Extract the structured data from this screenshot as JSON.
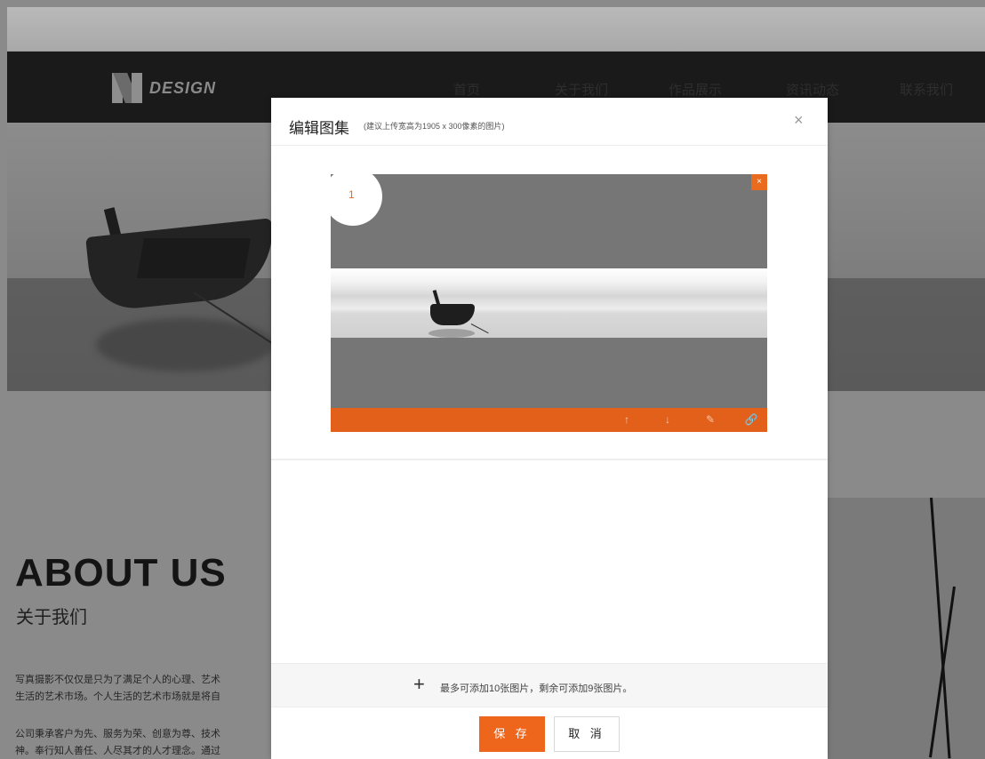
{
  "background_site": {
    "logo_text": "DESIGN",
    "nav": [
      "首页",
      "关于我们",
      "作品展示",
      "资讯动态",
      "联系我们"
    ],
    "about_title": "ABOUT US",
    "about_subtitle": "关于我们",
    "paragraph1_line1": "写真摄影不仅仅是只为了满足个人的心理、艺术",
    "paragraph1_line2": "生活的艺术市场。个人生活的艺术市场就是将自",
    "paragraph2_line1": "公司秉承客户为先、服务为荣、创意为尊、技术",
    "paragraph2_line2": "神。奉行知人善任、人尽其才的人才理念。通过"
  },
  "modal": {
    "title": "编辑图集",
    "hint": "(建议上传宽高为1905 x 300像素的图片)",
    "close_glyph": "×",
    "images": [
      {
        "index": "1",
        "delete_glyph": "×",
        "actions": {
          "move_up": "↑",
          "move_down": "↓",
          "edit": "✎",
          "link": "🔗"
        }
      }
    ],
    "add_glyph": "+",
    "add_text": "最多可添加10张图片，剩余可添加9张图片。",
    "save_label": "保 存",
    "cancel_label": "取 消"
  },
  "colors": {
    "accent": "#ee651c",
    "overlay_dim": "#8a8a8a"
  }
}
